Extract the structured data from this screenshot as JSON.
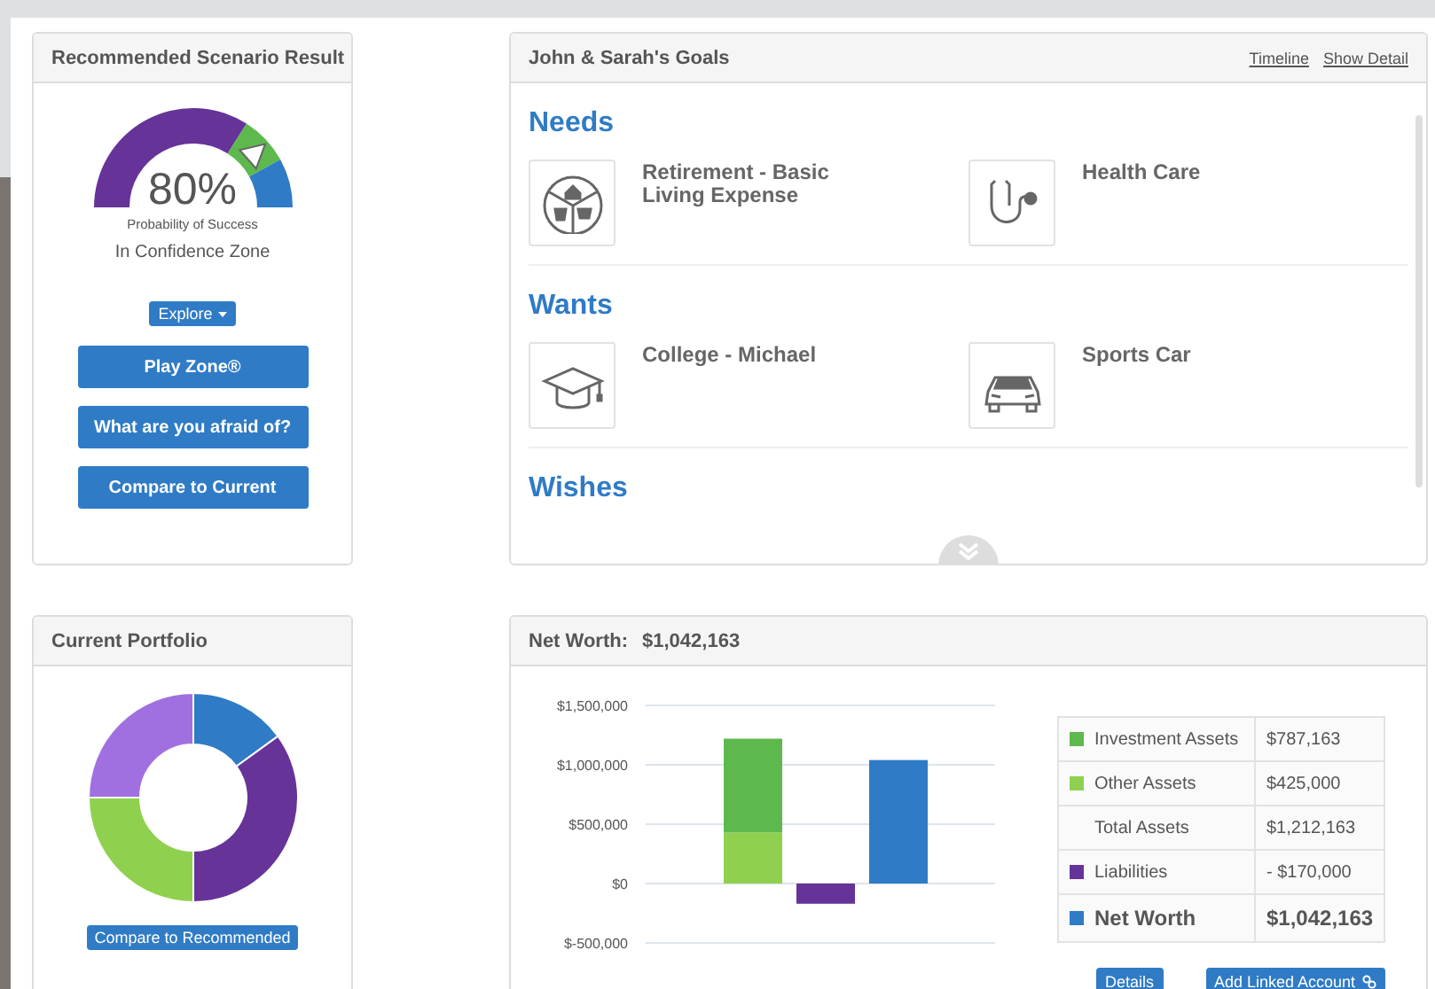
{
  "scenario": {
    "title": "Recommended Scenario Result",
    "gauge": {
      "value": "80%",
      "caption": "Probability of Success",
      "zone": "In Confidence Zone"
    },
    "explore": "Explore",
    "buttons": [
      "Play Zone®",
      "What are you afraid of?",
      "Compare to Current"
    ]
  },
  "goals": {
    "title": "John & Sarah's Goals",
    "links": [
      "Timeline",
      "Show Detail"
    ],
    "groups": [
      {
        "title": "Needs",
        "items": [
          {
            "label": "Retirement - Basic Living Expense",
            "kind": "living"
          },
          {
            "label": "Health Care",
            "kind": "health"
          }
        ]
      },
      {
        "title": "Wants",
        "items": [
          {
            "label": "College - Michael",
            "kind": "college"
          },
          {
            "label": "Sports Car",
            "kind": "car"
          }
        ]
      },
      {
        "title": "Wishes"
      }
    ]
  },
  "portfolio": {
    "title": "Current Portfolio",
    "button": "Compare to Recommended"
  },
  "net_worth": {
    "title": "Net Worth:",
    "amount": "$1,042,163",
    "chart_data": {
      "type": "bar",
      "stacked": true,
      "grid": true,
      "ylim": [
        -500000,
        1500000
      ],
      "yticks": [
        {
          "value": 1500000,
          "label": "$1,500,000"
        },
        {
          "value": 1000000,
          "label": "$1,000,000"
        },
        {
          "value": 500000,
          "label": "$500,000"
        },
        {
          "value": 0,
          "label": "$0"
        },
        {
          "value": -500000,
          "label": "$-500,000"
        }
      ],
      "series": [
        {
          "color": "#8fd14f",
          "values": [
            430000,
            null,
            null
          ]
        },
        {
          "color": "#5db94d",
          "values": [
            790000,
            null,
            null
          ]
        },
        {
          "color": "#663399",
          "values": [
            null,
            -170000,
            null
          ]
        },
        {
          "color": "#2f7bc6",
          "values": [
            null,
            null,
            1040000
          ]
        }
      ]
    },
    "legend": [
      {
        "kind": "item",
        "label": "Investment Assets",
        "value": "$787,163",
        "color": "#5db94d"
      },
      {
        "kind": "item",
        "label": "Other Assets",
        "value": "$425,000",
        "color": "#8fd14f"
      },
      {
        "kind": "subtotal",
        "label": "Total Assets",
        "value": "$1,212,163"
      },
      {
        "kind": "item",
        "label": "Liabilities",
        "value": "- $170,000",
        "color": "#663399"
      },
      {
        "kind": "total",
        "label": "Net Worth",
        "value": "$1,042,163",
        "color": "#2f7bc6"
      }
    ],
    "buttons": [
      "Details",
      "Add Linked Account"
    ]
  }
}
